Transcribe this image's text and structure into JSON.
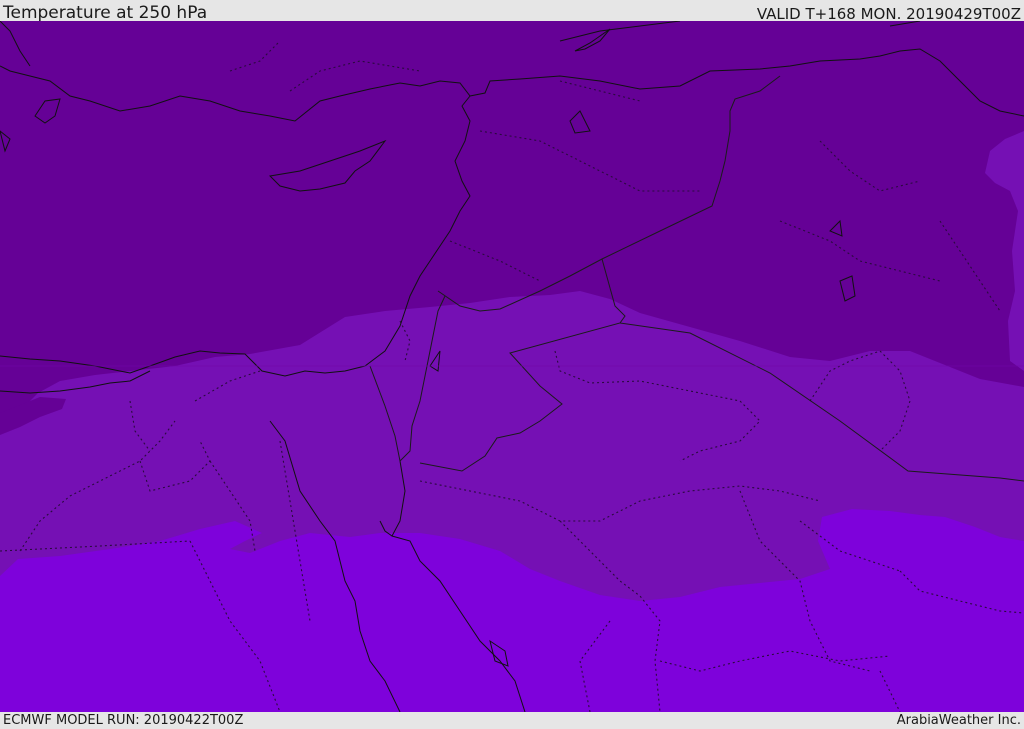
{
  "header": {
    "title": "Temperature at 250 hPa",
    "valid": "VALID T+168 MON. 20190429T00Z"
  },
  "footer": {
    "model_run": "ECMWF MODEL RUN: 20190422T00Z",
    "brand": "ArabiaWeather Inc."
  },
  "colors": {
    "band_cold": "#650196",
    "band_mid": "#7510b4",
    "band_warm": "#7e02db",
    "coastline": "#111111",
    "border": "#1b1b1b"
  }
}
